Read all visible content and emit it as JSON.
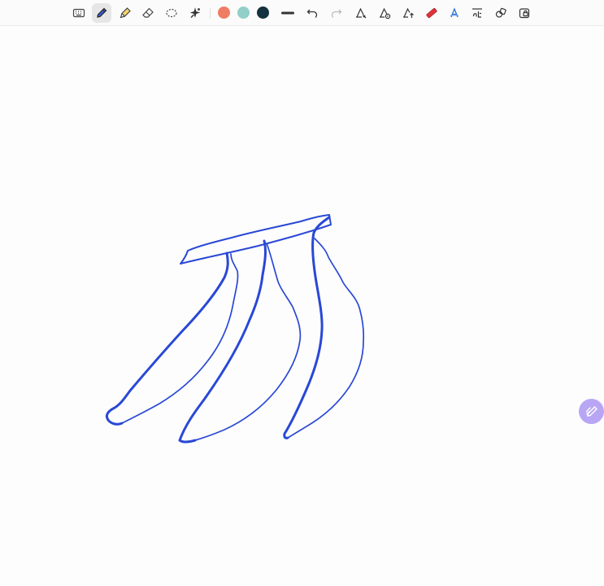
{
  "toolbar": {
    "tools": [
      {
        "name": "keyboard-tool",
        "icon": "keyboard-icon"
      },
      {
        "name": "pen-tool",
        "icon": "pen-icon",
        "active": true
      },
      {
        "name": "highlighter-tool",
        "icon": "highlighter-icon"
      },
      {
        "name": "eraser-tool",
        "icon": "eraser-icon"
      },
      {
        "name": "lasso-tool",
        "icon": "lasso-icon"
      },
      {
        "name": "magic-tool",
        "icon": "sparkle-icon"
      }
    ],
    "colors": [
      "#f07c64",
      "#92cfc8",
      "#14323f"
    ],
    "stroke_width": "thick",
    "actions": [
      {
        "name": "undo-button",
        "icon": "undo-icon"
      },
      {
        "name": "redo-button",
        "icon": "redo-icon"
      },
      {
        "name": "ink-to-shape-button",
        "icon": "ink-shape-icon"
      },
      {
        "name": "ink-replay-button",
        "icon": "ink-replay-icon"
      },
      {
        "name": "ink-upload-button",
        "icon": "ink-upload-icon"
      },
      {
        "name": "ruler-button",
        "icon": "ruler-icon"
      },
      {
        "name": "ink-to-text-button",
        "icon": "ink-text-icon"
      },
      {
        "name": "math-button",
        "icon": "math-icon"
      },
      {
        "name": "shapes-button",
        "icon": "shapes-icon"
      },
      {
        "name": "lock-button",
        "icon": "lock-icon"
      }
    ]
  },
  "canvas": {
    "ink_color": "#2948d6",
    "drawing": "bananas-sketch"
  },
  "fab": {
    "icon": "pen-fab-icon",
    "color": "#b8a6f5"
  }
}
